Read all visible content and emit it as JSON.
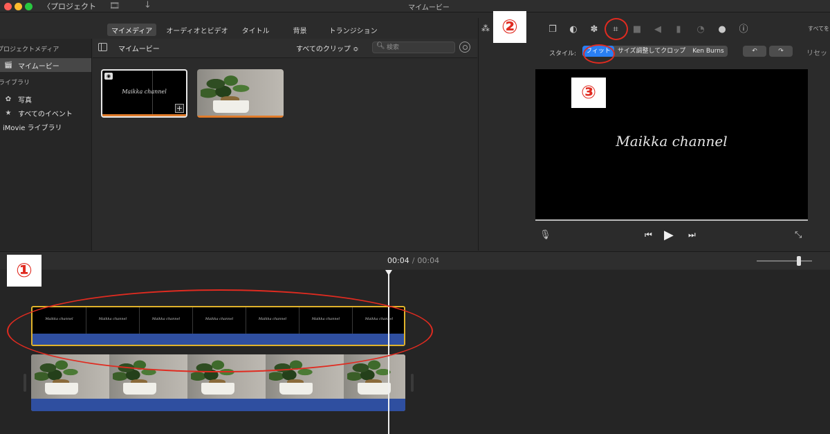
{
  "window": {
    "title": "マイムービー",
    "back_label": "〈プロジェクト"
  },
  "top_tabs": [
    {
      "label": "マイメディア",
      "active": true
    },
    {
      "label": "オーディオとビデオ",
      "active": false
    },
    {
      "label": "タイトル",
      "active": false
    },
    {
      "label": "背景",
      "active": false
    },
    {
      "label": "トランジション",
      "active": false
    }
  ],
  "sidebar": {
    "section_project_media": "プロジェクトメディア",
    "project_item": "マイムービー",
    "section_library": "ライブラリ",
    "library_items": [
      {
        "label": "写真",
        "icon": "flower-icon"
      },
      {
        "label": "すべてのイベント",
        "icon": "star-icon"
      }
    ],
    "imovie_library": "iMovie ライブラリ"
  },
  "browser": {
    "title": "マイムービー",
    "clip_filter": "すべてのクリップ ≎",
    "search_placeholder": "検索",
    "title_clip_text": "Maikka channel"
  },
  "viewer": {
    "all_label": "すべてを",
    "style_label": "スタイル:",
    "style_options": [
      {
        "label": "フィット",
        "active": true
      },
      {
        "label": "サイズ調整してクロップ",
        "active": false
      },
      {
        "label": "Ken Burns",
        "active": false
      }
    ],
    "reset_label": "リセッ",
    "screen_text": "Maikka channel"
  },
  "annotations": {
    "one": "①",
    "two": "②",
    "three": "③"
  },
  "timeline": {
    "current_time": "00:04",
    "separator": "/",
    "total_time": "00:04",
    "title_track_text": "Maikka channel"
  },
  "colors": {
    "accent_blue": "#2a7ff3",
    "annotation_red": "#e02b20",
    "selection_yellow": "#e1b32b",
    "audio_blue": "#2f4fa0",
    "clip_orange": "#e07b2a"
  }
}
